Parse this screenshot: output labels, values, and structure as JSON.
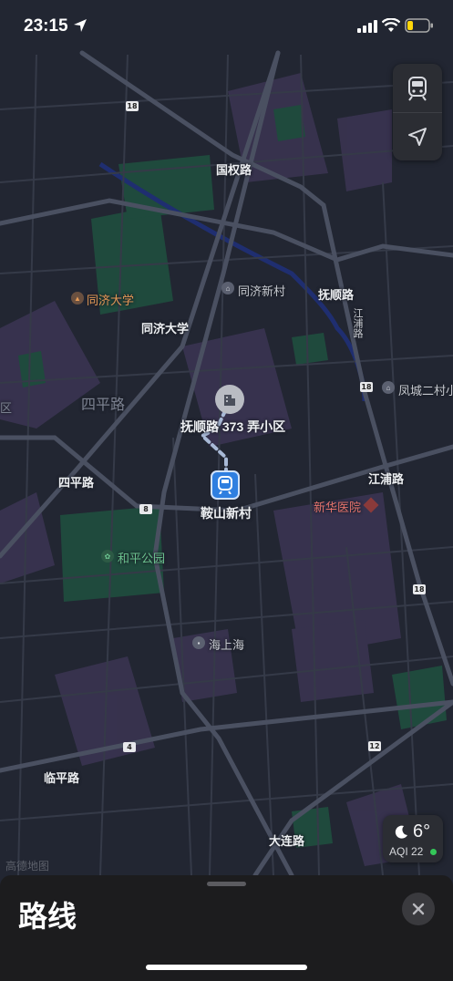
{
  "status_bar": {
    "time": "23:15"
  },
  "map": {
    "labels": {
      "guoquan_road": "国权路",
      "tongji_univ_poi": "同济大学",
      "tongji_univ_road": "同济大学",
      "tongji_xincun": "同济新村",
      "fushun_road": "抚顺路",
      "jiangpu_road_vertical": "江浦路",
      "fengcheng": "凤城二村小",
      "siping_road_big": "四平路",
      "siping_road": "四平路",
      "destination": "抚顺路 373 弄小区",
      "station": "鞍山新村",
      "jiangpu_road": "江浦路",
      "xinhua_hospital": "新华医院",
      "heping_park": "和平公园",
      "haishanghai": "海上海",
      "linping_road": "临平路",
      "dalian_road": "大连路",
      "district_edge": "区"
    },
    "shields": {
      "s18a": "18",
      "s18b": "18",
      "s18c": "18",
      "s8": "8",
      "s4": "4",
      "s12": "12"
    },
    "attribution": "高德地图"
  },
  "controls": {
    "transit_icon": "train-icon",
    "location_icon": "location-arrow-icon"
  },
  "weather": {
    "temp": "6°",
    "aqi": "AQI 22"
  },
  "sheet": {
    "title": "路线"
  }
}
